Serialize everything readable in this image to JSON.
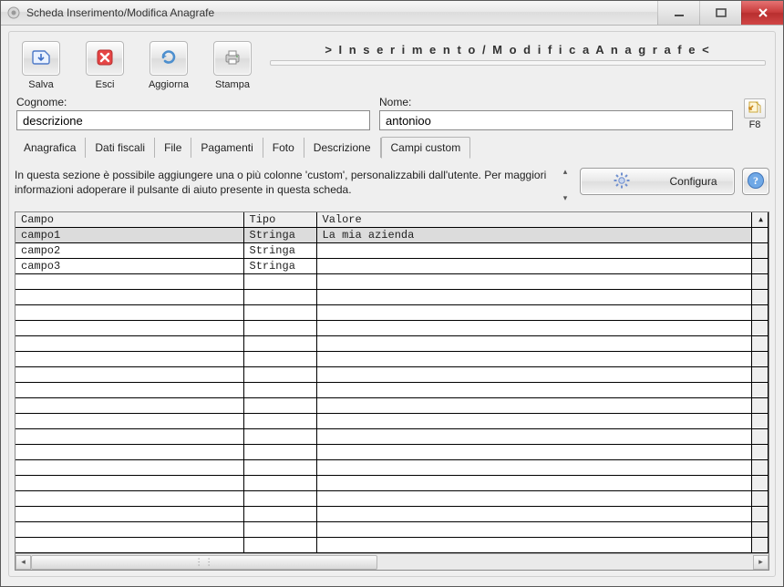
{
  "window": {
    "title": "Scheda Inserimento/Modifica Anagrafe"
  },
  "header": {
    "banner": "> I n s e r i m e n t o   /   M o d i f i c a   A n a g r a f e <"
  },
  "toolbar": {
    "salva": "Salva",
    "esci": "Esci",
    "aggiorna": "Aggiorna",
    "stampa": "Stampa"
  },
  "form": {
    "cognome_label": "Cognome:",
    "cognome_value": "descrizione",
    "nome_label": "Nome:",
    "nome_value": "antonioo",
    "f8_label": "F8"
  },
  "tabs": {
    "items": [
      {
        "label": "Anagrafica",
        "active": false
      },
      {
        "label": "Dati fiscali",
        "active": false
      },
      {
        "label": "File",
        "active": false
      },
      {
        "label": "Pagamenti",
        "active": false
      },
      {
        "label": "Foto",
        "active": false
      },
      {
        "label": "Descrizione",
        "active": false
      },
      {
        "label": "Campi custom",
        "active": true
      }
    ]
  },
  "section": {
    "help_text": "In questa sezione è possibile aggiungere una o più colonne 'custom', personalizzabili dall'utente. Per maggiori informazioni adoperare il pulsante di aiuto presente in questa scheda.",
    "configure_label": "Configura"
  },
  "table": {
    "columns": {
      "campo": "Campo",
      "tipo": "Tipo",
      "valore": "Valore"
    },
    "rows": [
      {
        "campo": "campo1",
        "tipo": "Stringa",
        "valore": "La mia azienda",
        "selected": true
      },
      {
        "campo": "campo2",
        "tipo": "Stringa",
        "valore": ""
      },
      {
        "campo": "campo3",
        "tipo": "Stringa",
        "valore": ""
      }
    ],
    "blank_rows": 18
  }
}
